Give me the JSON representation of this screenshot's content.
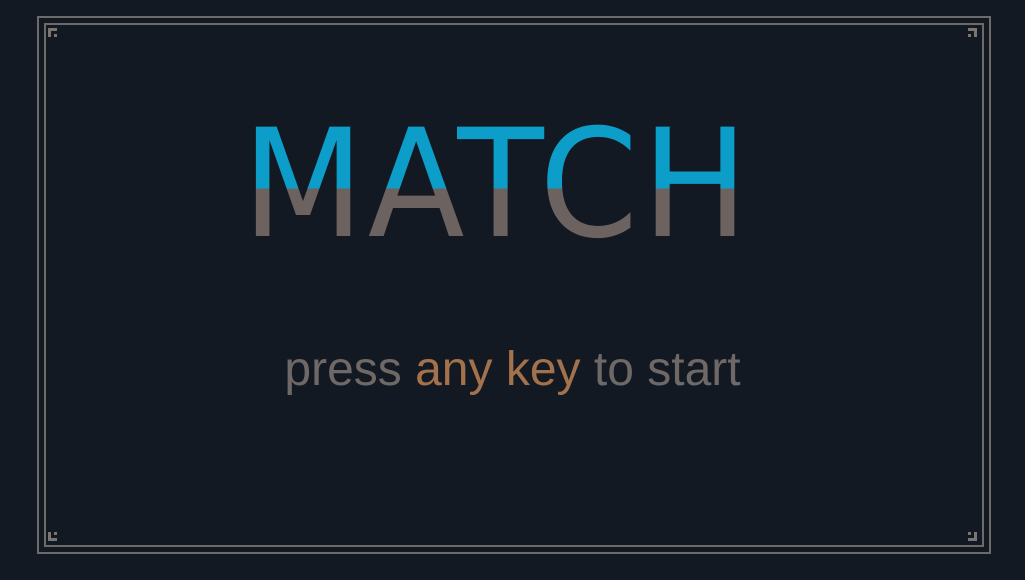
{
  "title": {
    "text": "MATCH",
    "top_color": "#0c9dc9",
    "bottom_color": "#6c6260"
  },
  "prompt": {
    "before": "press ",
    "highlight": "any key",
    "after": " to start",
    "text_color": "#6e6866",
    "highlight_color": "#a3714b"
  },
  "frame": {
    "border_color": "#6e6a68",
    "background": "#131922"
  }
}
